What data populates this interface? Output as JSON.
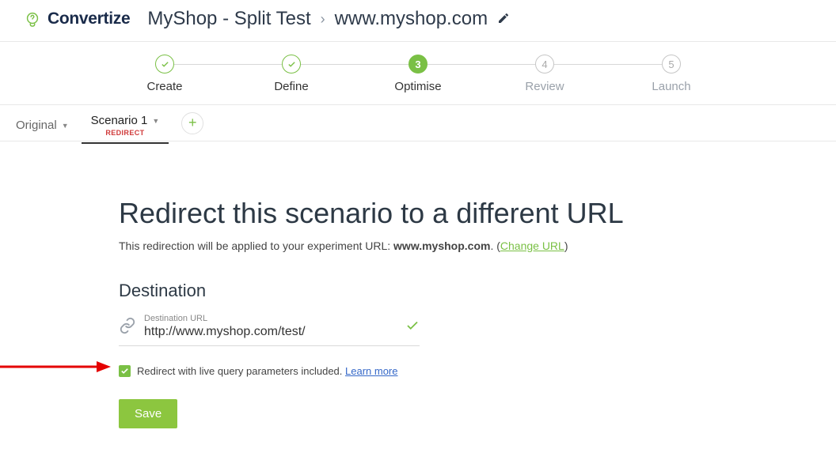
{
  "brand": "Convertize",
  "breadcrumb": {
    "project": "MyShop - Split Test",
    "url": "www.myshop.com"
  },
  "steps": [
    {
      "num": "✓",
      "label": "Create",
      "state": "done"
    },
    {
      "num": "✓",
      "label": "Define",
      "state": "done"
    },
    {
      "num": "3",
      "label": "Optimise",
      "state": "active"
    },
    {
      "num": "4",
      "label": "Review",
      "state": "future"
    },
    {
      "num": "5",
      "label": "Launch",
      "state": "future"
    }
  ],
  "tabs": {
    "original": "Original",
    "scenario": "Scenario 1",
    "redirect_badge": "REDIRECT"
  },
  "page": {
    "title": "Redirect this scenario to a different URL",
    "sub_prefix": "This redirection will be applied to your experiment URL: ",
    "sub_url": "www.myshop.com",
    "sub_suffix": ". (",
    "change_url": "Change URL",
    "sub_close": ")"
  },
  "destination": {
    "heading": "Destination",
    "label": "Destination URL",
    "value": "http://www.myshop.com/test/"
  },
  "checkbox": {
    "text": "Redirect with live query parameters included. ",
    "learn": "Learn more"
  },
  "save": "Save"
}
